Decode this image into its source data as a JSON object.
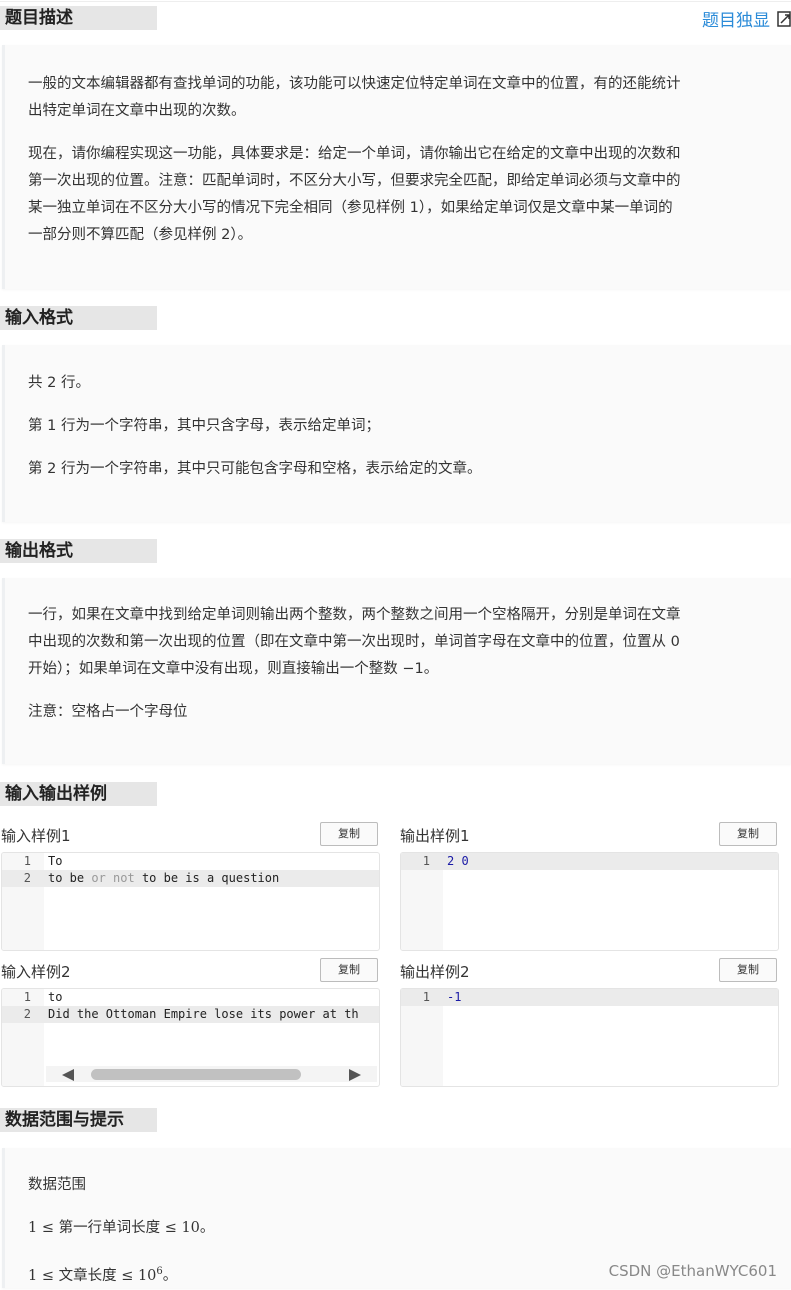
{
  "header": {
    "title": "题目描述",
    "solo_link": "题目独显"
  },
  "description": {
    "p1_l1": "一般的文本编辑器都有查找单词的功能，该功能可以快速定位特定单词在文章中的位置，有的还能统计",
    "p1_l2": "出特定单词在文章中出现的次数。",
    "p2_l1": "现在，请你编程实现这一功能，具体要求是：给定一个单词，请你输出它在给定的文章中出现的次数和",
    "p2_l2": "第一次出现的位置。注意：匹配单词时，不区分大小写，但要求完全匹配，即给定单词必须与文章中的",
    "p2_l3": "某一独立单词在不区分大小写的情况下完全相同（参见样例 1），如果给定单词仅是文章中某一单词的",
    "p2_l4": "一部分则不算匹配（参见样例 2）。"
  },
  "input_format": {
    "title": "输入格式",
    "l1": "共 2 行。",
    "l2": "第 1 行为一个字符串，其中只含字母，表示给定单词；",
    "l3": "第 2 行为一个字符串，其中只可能包含字母和空格，表示给定的文章。"
  },
  "output_format": {
    "title": "输出格式",
    "l1": "一行，如果在文章中找到给定单词则输出两个整数，两个整数之间用一个空格隔开，分别是单词在文章",
    "l2": "中出现的次数和第一次出现的位置（即在文章中第一次出现时，单词首字母在文章中的位置，位置从 0",
    "l3": "开始）；如果单词在文章中没有出现，则直接输出一个整数 −1。",
    "note": "注意：空格占一个字母位"
  },
  "samples": {
    "title": "输入输出样例",
    "copy_label": "复制",
    "in1": {
      "label": "输入样例1",
      "lines": [
        {
          "n": "1",
          "text": "To"
        },
        {
          "n": "2",
          "text": "to be or not to be is a question"
        }
      ]
    },
    "out1": {
      "label": "输出样例1",
      "lines": [
        {
          "n": "1",
          "text": "2 0"
        }
      ]
    },
    "in2": {
      "label": "输入样例2",
      "lines": [
        {
          "n": "1",
          "text": "to"
        },
        {
          "n": "2",
          "text": "Did the Ottoman Empire lose its power at th"
        }
      ]
    },
    "out2": {
      "label": "输出样例2",
      "lines": [
        {
          "n": "1",
          "text": "-1"
        }
      ]
    }
  },
  "data_range": {
    "title": "数据范围与提示",
    "heading": "数据范围",
    "r1_pre": "1 ≤ ",
    "r1_mid": "第一行单词长度",
    "r1_post": " ≤ 10",
    "r1_end": "。",
    "r2_pre": "1 ≤ ",
    "r2_mid": "文章长度",
    "r2_post": " ≤ 10",
    "r2_exp": "6",
    "r2_end": "。"
  },
  "watermark": "CSDN @EthanWYC601"
}
